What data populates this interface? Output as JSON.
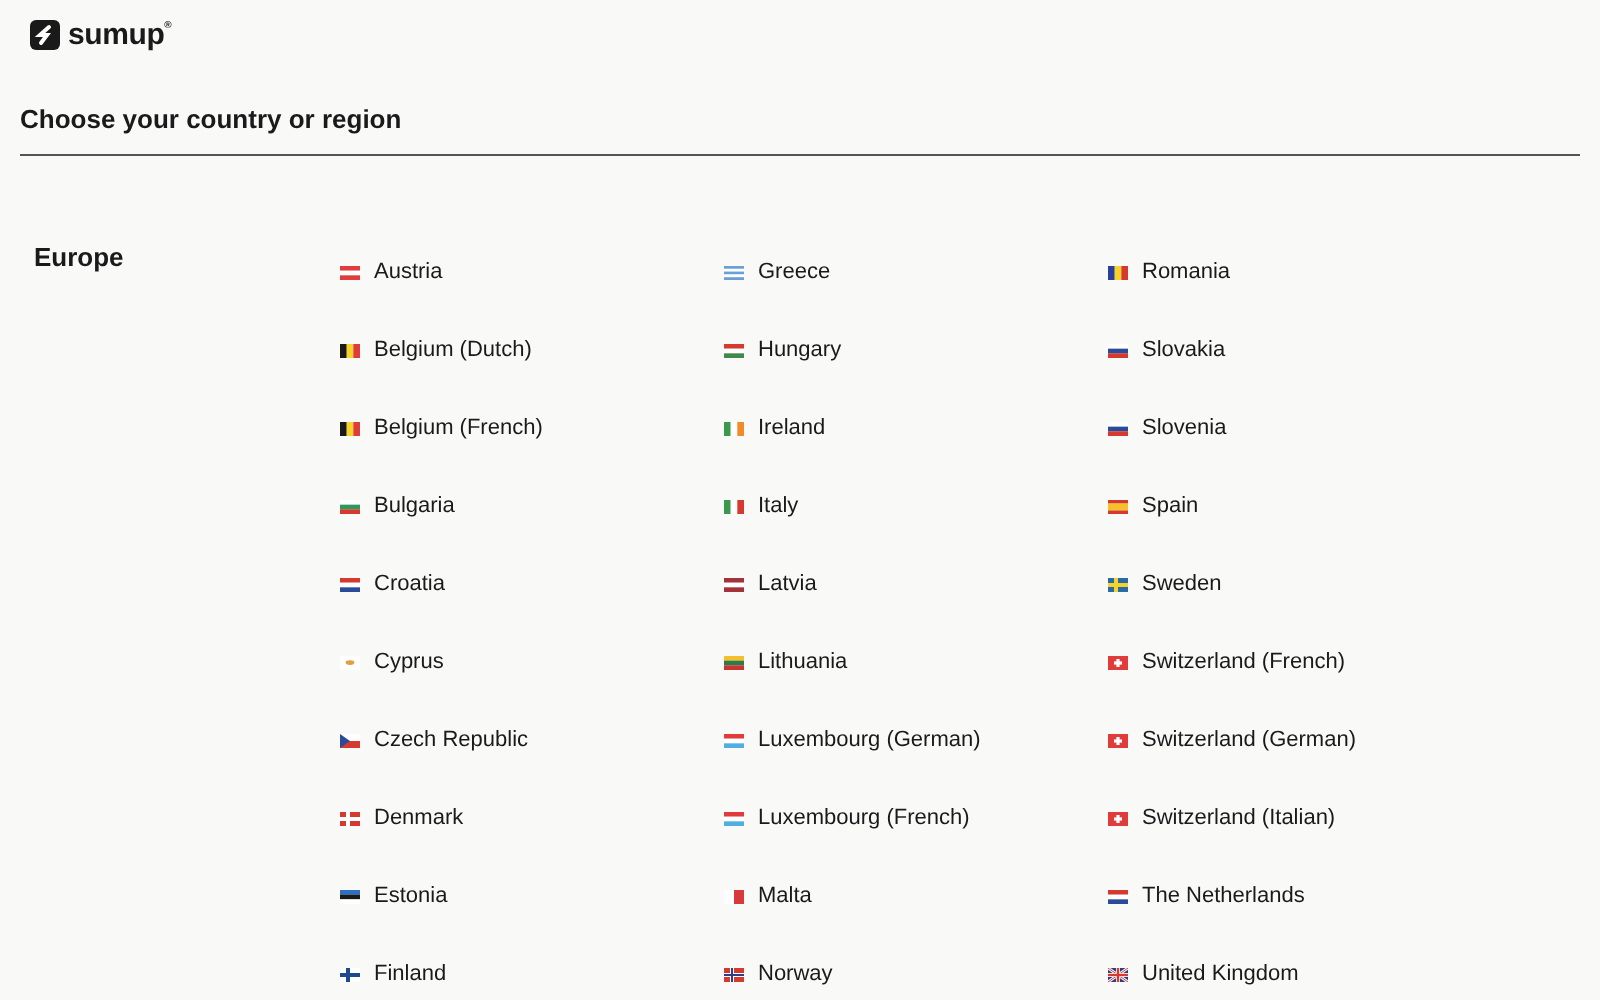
{
  "header": {
    "logo_text": "sumup$^{®}$"
  },
  "title": "Choose your country or region",
  "regions": [
    {
      "name": "Europe",
      "countries": [
        {
          "label": "Austria"
        },
        {
          "label": "Belgium (Dutch)"
        },
        {
          "label": "Belgium (French)"
        },
        {
          "label": "Bulgaria"
        },
        {
          "label": "Croatia"
        },
        {
          "label": "Cyprus"
        },
        {
          "label": "Czech Republic"
        },
        {
          "label": "Denmark"
        },
        {
          "label": "Estonia"
        },
        {
          "label": "Finland"
        },
        {
          "label": "Greece"
        },
        {
          "label": "Hungary"
        },
        {
          "label": "Ireland"
        },
        {
          "label": "Italy"
        },
        {
          "label": "Latvia"
        },
        {
          "label": "Lithuania"
        },
        {
          "label": "Luxembourg (German)"
        },
        {
          "label": "Luxembourg (French)"
        },
        {
          "label": "Malta"
        },
        {
          "label": "Norway"
        },
        {
          "label": "Romania"
        },
        {
          "label": "Slovakia"
        },
        {
          "label": "Slovenia"
        },
        {
          "label": "Spain"
        },
        {
          "label": "Sweden"
        },
        {
          "label": "Switzerland (French)"
        },
        {
          "label": "Switzerland (German)"
        },
        {
          "label": "Switzerland (Italian)"
        },
        {
          "label": "The Netherlands"
        },
        {
          "label": "United Kingdom"
        }
      ]
    }
  ]
}
